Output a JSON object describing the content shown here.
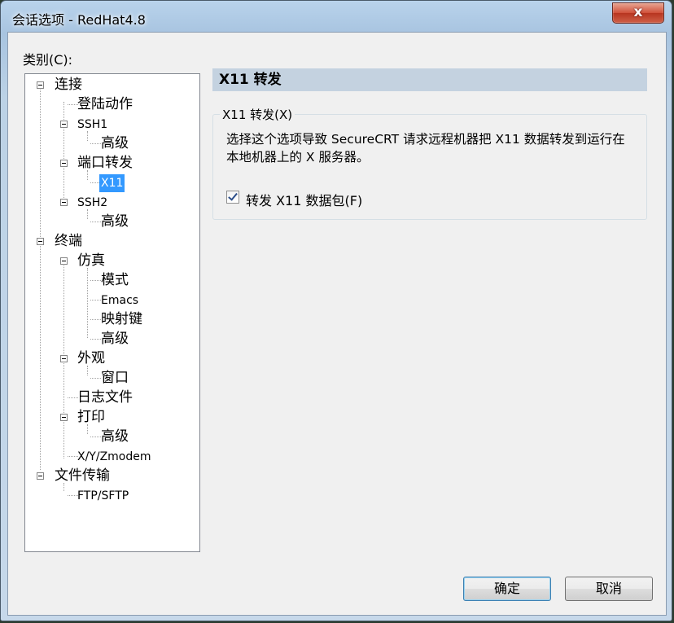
{
  "window": {
    "title": "会话选项 - RedHat4.8",
    "close_glyph": "x"
  },
  "category_label": "类别(C):",
  "tree": [
    {
      "label": "连接",
      "expander": true
    },
    {
      "label": "登陆动作"
    },
    {
      "label": "SSH1",
      "expander": true
    },
    {
      "label": "高级"
    },
    {
      "label": "端口转发",
      "expander": true
    },
    {
      "label": "X11",
      "selected": true
    },
    {
      "label": "SSH2",
      "expander": true
    },
    {
      "label": "高级"
    },
    {
      "label": "终端",
      "expander": true
    },
    {
      "label": "仿真",
      "expander": true
    },
    {
      "label": "模式"
    },
    {
      "label": "Emacs"
    },
    {
      "label": "映射键"
    },
    {
      "label": "高级"
    },
    {
      "label": "外观",
      "expander": true
    },
    {
      "label": "窗口"
    },
    {
      "label": "日志文件"
    },
    {
      "label": "打印",
      "expander": true
    },
    {
      "label": "高级"
    },
    {
      "label": "X/Y/Zmodem"
    },
    {
      "label": "文件传输",
      "expander": true
    },
    {
      "label": "FTP/SFTP"
    }
  ],
  "panel": {
    "header": "X11 转发",
    "group_title": "X11 转发(X)",
    "description": "选择这个选项导致 SecureCRT 请求远程机器把 X11 数据转发到运行在本地机器上的 X 服务器。",
    "checkbox_label": "转发 X11 数据包(F)",
    "checkbox_checked": true
  },
  "buttons": {
    "ok": "确定",
    "cancel": "取消"
  }
}
